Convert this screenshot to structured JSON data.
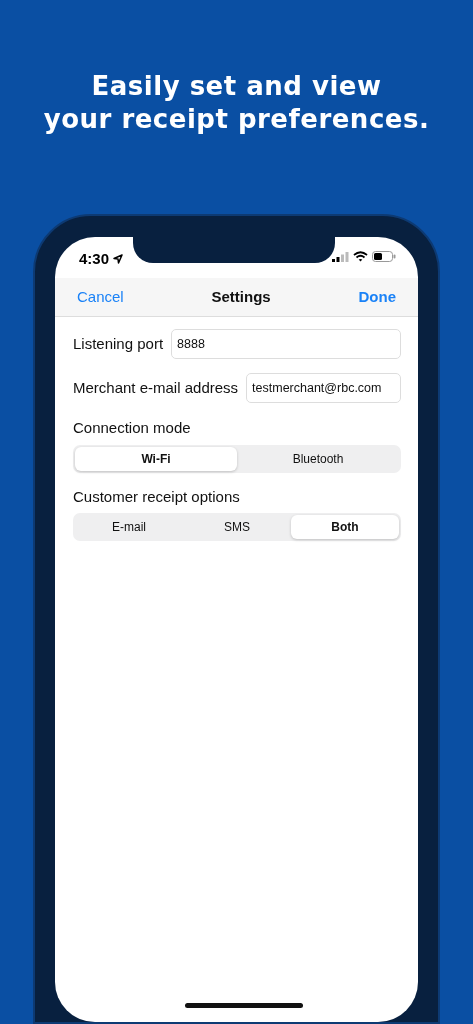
{
  "headline": [
    "Easily set and view",
    "your receipt preferences."
  ],
  "status_bar": {
    "time": "4:30"
  },
  "nav_bar": {
    "left": "Cancel",
    "title": "Settings",
    "right": "Done"
  },
  "fields": [
    {
      "label": "Listening port",
      "value": "8888"
    },
    {
      "label": "Merchant e-mail address",
      "value": "testmerchant@rbc.com"
    }
  ],
  "segment_groups": [
    {
      "label": "Connection mode",
      "options": [
        {
          "label": "Wi-Fi",
          "selected": true
        },
        {
          "label": "Bluetooth",
          "selected": false
        }
      ]
    },
    {
      "label": "Customer receipt options",
      "options": [
        {
          "label": "E-mail",
          "selected": false
        },
        {
          "label": "SMS",
          "selected": false
        },
        {
          "label": "Both",
          "selected": true
        }
      ]
    }
  ]
}
